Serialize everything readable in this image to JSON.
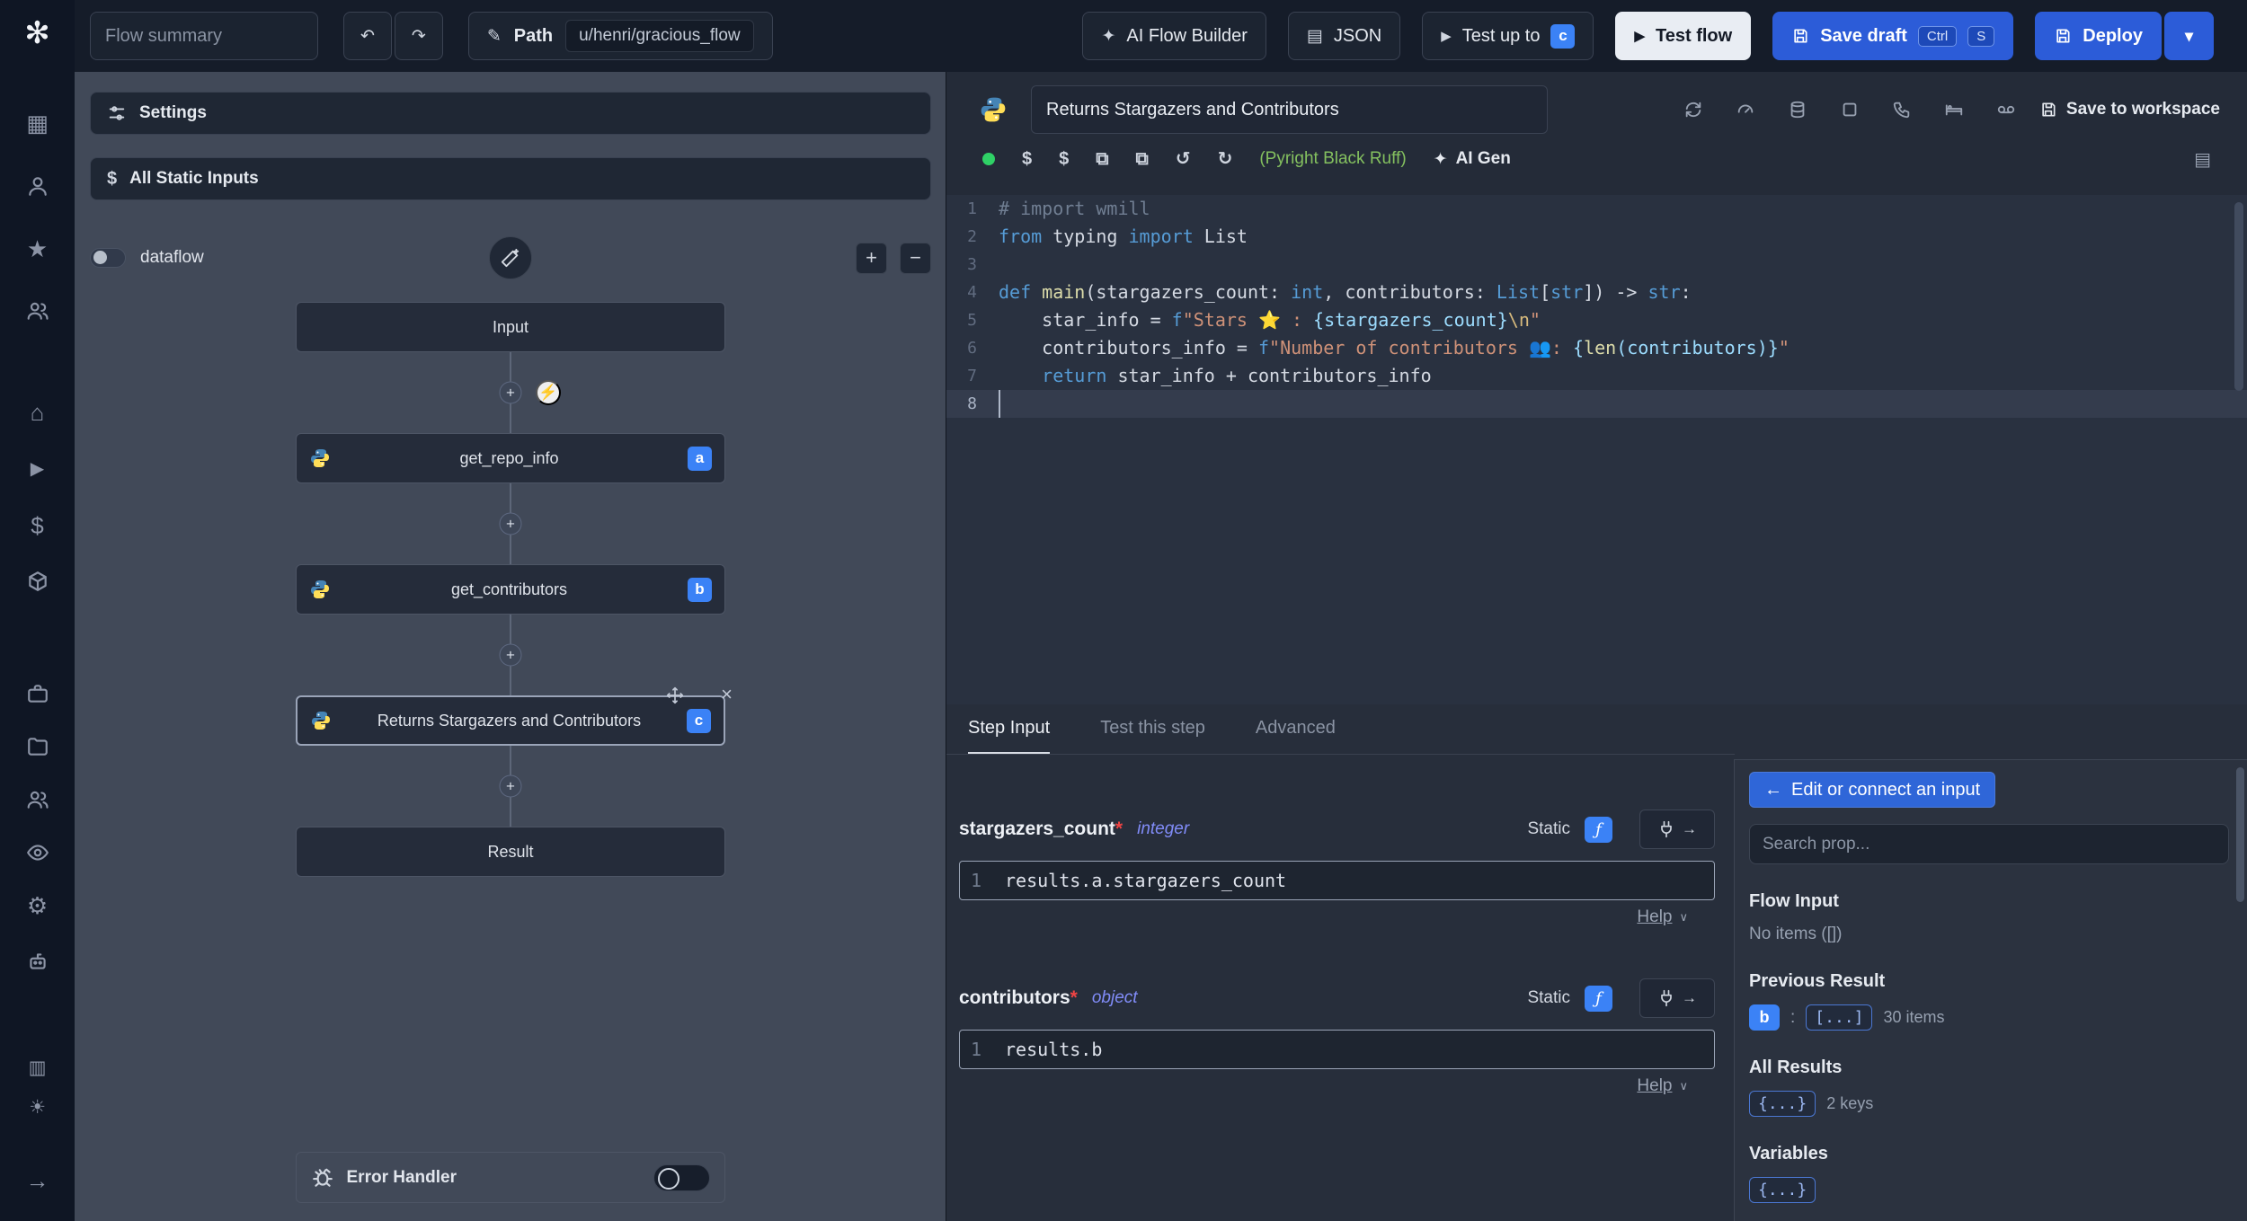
{
  "icons": {
    "logo": "✻",
    "grid": "▦",
    "star": "★",
    "home": "⌂",
    "play": "▶",
    "dollar": "$",
    "gear": "⚙",
    "columns": "▥",
    "sun": "☀",
    "arrow_right": "→",
    "arrow_left": "←",
    "undo": "↶",
    "redo": "↷",
    "pencil": "✎",
    "chevron_down": "▾",
    "plus": "+",
    "minus": "−",
    "close": "×",
    "bolt": "⚡",
    "sparkle": "✦",
    "reset": "↺",
    "reload": "↻",
    "package": "⧉",
    "func": "ƒ",
    "help_chevron": "∨",
    "book": "▤",
    "doc": "▤"
  },
  "topbar": {
    "flow_summary_placeholder": "Flow summary",
    "path_label": "Path",
    "path_value": "u/henri/gracious_flow",
    "ai_flow_builder": "AI Flow Builder",
    "json": "JSON",
    "test_up_to": "Test up to",
    "test_up_to_badge": "c",
    "test_flow": "Test flow",
    "save_draft": "Save draft",
    "save_draft_kbd1": "Ctrl",
    "save_draft_kbd2": "S",
    "deploy": "Deploy"
  },
  "flow": {
    "settings": "Settings",
    "all_static_inputs": "All Static Inputs",
    "dataflow_label": "dataflow",
    "input_node": "Input",
    "result_node": "Result",
    "modules": [
      {
        "label": "get_repo_info",
        "badge": "a"
      },
      {
        "label": "get_contributors",
        "badge": "b"
      },
      {
        "label": "Returns Stargazers and Contributors",
        "badge": "c"
      }
    ],
    "error_handler": "Error Handler"
  },
  "editor": {
    "title": "Returns Stargazers and Contributors",
    "save_to_workspace": "Save to workspace",
    "assistants": "(Pyright Black Ruff)",
    "ai_gen": "AI Gen",
    "active_line": 8,
    "code_lines": [
      [
        {
          "t": "# import wmill",
          "c": "comment"
        }
      ],
      [
        {
          "t": "from",
          "c": "kw"
        },
        {
          "t": " typing ",
          "c": "plain"
        },
        {
          "t": "import",
          "c": "kw"
        },
        {
          "t": " List",
          "c": "plain"
        }
      ],
      [],
      [
        {
          "t": "def",
          "c": "kw"
        },
        {
          "t": " ",
          "c": "plain"
        },
        {
          "t": "main",
          "c": "fn"
        },
        {
          "t": "(stargazers_count: ",
          "c": "plain"
        },
        {
          "t": "int",
          "c": "type"
        },
        {
          "t": ", contributors: ",
          "c": "plain"
        },
        {
          "t": "List",
          "c": "type"
        },
        {
          "t": "[",
          "c": "plain"
        },
        {
          "t": "str",
          "c": "type"
        },
        {
          "t": "]) -> ",
          "c": "plain"
        },
        {
          "t": "str",
          "c": "type"
        },
        {
          "t": ":",
          "c": "plain"
        }
      ],
      [
        {
          "t": "    star_info = ",
          "c": "plain"
        },
        {
          "t": "f",
          "c": "kw"
        },
        {
          "t": "\"Stars ",
          "c": "str"
        },
        {
          "t": "⭐",
          "c": "emoji"
        },
        {
          "t": " : ",
          "c": "str"
        },
        {
          "t": "{stargazers_count}",
          "c": "interp"
        },
        {
          "t": "\\n",
          "c": "esc"
        },
        {
          "t": "\"",
          "c": "str"
        }
      ],
      [
        {
          "t": "    contributors_info = ",
          "c": "plain"
        },
        {
          "t": "f",
          "c": "kw"
        },
        {
          "t": "\"Number of contributors ",
          "c": "str"
        },
        {
          "t": "👥",
          "c": "emoji"
        },
        {
          "t": ": ",
          "c": "str"
        },
        {
          "t": "{",
          "c": "interp"
        },
        {
          "t": "len",
          "c": "fn"
        },
        {
          "t": "(contributors)}",
          "c": "interp"
        },
        {
          "t": "\"",
          "c": "str"
        }
      ],
      [
        {
          "t": "    ",
          "c": "plain"
        },
        {
          "t": "return",
          "c": "kw"
        },
        {
          "t": " star_info + contributors_info",
          "c": "plain"
        }
      ],
      []
    ]
  },
  "step": {
    "tabs": {
      "step_input": "Step Input",
      "test_this_step": "Test this step",
      "advanced": "Advanced"
    },
    "fields": [
      {
        "name": "stargazers_count",
        "required": "*",
        "type": "integer",
        "mode": "Static",
        "line": "1",
        "expr": "results.a.stargazers_count",
        "help": "Help"
      },
      {
        "name": "contributors",
        "required": "*",
        "type": "object",
        "mode": "Static",
        "line": "1",
        "expr": "results.b",
        "help": "Help"
      }
    ]
  },
  "props": {
    "edit_connect": "Edit or connect an input",
    "search_placeholder": "Search prop...",
    "flow_input": {
      "title": "Flow Input",
      "empty": "No items ([])"
    },
    "previous_result": {
      "title": "Previous Result",
      "key": "b",
      "colon": ":",
      "collapsed": "[...]",
      "count": "30 items"
    },
    "all_results": {
      "title": "All Results",
      "collapsed": "{...}",
      "count": "2 keys"
    },
    "variables": {
      "title": "Variables",
      "collapsed": "{...}"
    }
  },
  "colors": {
    "accent_blue": "#3b82f6",
    "button_blue": "#2c5cd8",
    "status_green": "#2fd166",
    "assistant_green": "#84c05f",
    "type_italic_blue": "#818cf8",
    "required_red": "#ef4444"
  }
}
